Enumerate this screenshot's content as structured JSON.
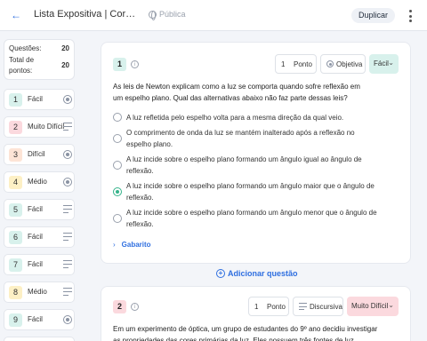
{
  "header": {
    "back_icon": "arrow-left-icon",
    "title": "Lista Expositiva | Cores Primárias",
    "visibility": "Pública",
    "duplicate_label": "Duplicar",
    "more_icon": "more-vertical-icon"
  },
  "summary": {
    "questions_label": "Questões:",
    "questions_value": "20",
    "points_label": "Total de pontos:",
    "points_value": "20"
  },
  "sidebar": {
    "items": [
      {
        "num": "1",
        "label": "Fácil",
        "icon": "radio-icon"
      },
      {
        "num": "2",
        "label": "Muito Difícil",
        "icon": "text-lines-icon"
      },
      {
        "num": "3",
        "label": "Difícil",
        "icon": "radio-icon"
      },
      {
        "num": "4",
        "label": "Médio",
        "icon": "radio-icon"
      },
      {
        "num": "5",
        "label": "Fácil",
        "icon": "text-lines-icon"
      },
      {
        "num": "6",
        "label": "Fácil",
        "icon": "text-lines-icon"
      },
      {
        "num": "7",
        "label": "Fácil",
        "icon": "text-lines-icon"
      },
      {
        "num": "8",
        "label": "Médio",
        "icon": "text-lines-icon"
      },
      {
        "num": "9",
        "label": "Fácil",
        "icon": "radio-icon"
      }
    ]
  },
  "question1": {
    "num": "1",
    "points_value": "1",
    "points_label": "Ponto",
    "type_label": "Objetiva",
    "difficulty": "Fácil",
    "text": "As leis de Newton explicam como a luz se comporta quando sofre reflexão em um espelho plano. Qual das alternativas abaixo não faz parte dessas leis?",
    "options": [
      "A luz refletida pelo espelho volta para a mesma direção da qual veio.",
      "O comprimento de onda da luz se mantém inalterado após a reflexão no espelho plano.",
      "A luz incide sobre o espelho plano formando um ângulo igual ao ângulo de reflexão.",
      "A luz incide sobre o espelho plano formando um ângulo maior que o ângulo de reflexão.",
      "A luz incide sobre o espelho plano formando um ângulo menor que o ângulo de reflexão."
    ],
    "selected_index": 3,
    "answer_key_label": "Gabarito"
  },
  "add_question_label": "Adicionar questão",
  "question2": {
    "num": "2",
    "points_value": "1",
    "points_label": "Ponto",
    "type_label": "Discursiva",
    "difficulty": "Muito Difícil",
    "text": "Em um experimento de óptica, um grupo de estudantes do 9º ano decidiu investigar as propriedades das cores primárias da luz. Eles possuem três fontes de luz"
  },
  "colors": {
    "accent": "#2f6fe0",
    "facil": "#d8f1ec",
    "medio": "#fdf0c5",
    "dificil": "#fde4d6",
    "muito_dificil": "#fbd9de",
    "selected": "#35b38a"
  }
}
